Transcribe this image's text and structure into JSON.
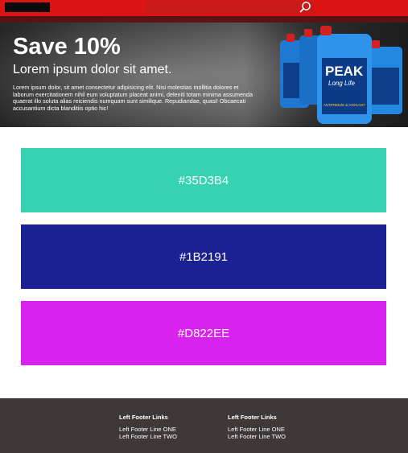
{
  "header": {
    "search": {
      "placeholder": ""
    },
    "icons": {
      "logo": "logo-block",
      "search": "search-icon"
    }
  },
  "hero": {
    "title": "Save 10%",
    "subtitle": "Lorem ipsum dolor sit amet.",
    "body": "Lorem ipsum dolor, sit amet consectetur adipisicing elit. Nisi molestias mollitia dolores et laborum exercitationem nihil eum voluptatum placeat animi, deleniti totam minima assumenda quaerat illo soluta alias reiciendis numquam sunt similique. Repudiandae, quasi! Obcaecati accusantium dicta blanditiis optio hic!",
    "product_brand": "PEAK",
    "product_line": "Long Life",
    "product_label": "ANTIFREEZE & COOLANT"
  },
  "swatches": [
    {
      "label": "#35D3B4",
      "color": "#35D3B4"
    },
    {
      "label": "#1B2191",
      "color": "#1B2191"
    },
    {
      "label": "#D822EE",
      "color": "#D822EE"
    }
  ],
  "footer": {
    "columns": [
      {
        "heading": "Left Footer Links",
        "links": [
          "Left Footer Line ONE",
          "Left Footer Line TWO"
        ]
      },
      {
        "heading": "Left Footer Links",
        "links": [
          "Left Footer Line ONE",
          "Left Footer Line TWO"
        ]
      }
    ]
  },
  "colors": {
    "topbar": "#db1414",
    "footer": "#3e3838"
  }
}
